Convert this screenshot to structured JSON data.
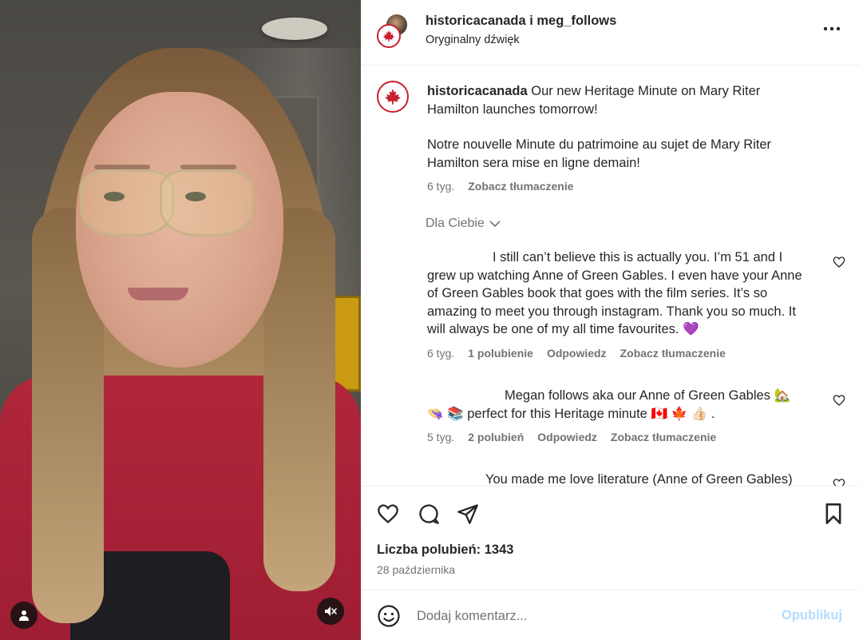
{
  "post_header": {
    "usernames": "historicacanada i meg_follows",
    "audio": "Oryginalny dźwięk",
    "more_icon": "more-horizontal-icon"
  },
  "caption": {
    "username": "historicacanada",
    "text_en": "Our new Heritage Minute on Mary Riter Hamilton launches tomorrow!",
    "text_fr": "Notre nouvelle Minute du patrimoine au sujet de Mary Riter Hamilton sera mise en ligne demain!",
    "time": "6 tyg.",
    "translate": "Zobacz tłumaczenie"
  },
  "filter": {
    "label": "Dla Ciebie"
  },
  "comments": [
    {
      "text": "I still can’t believe this is actually you. I’m 51 and I grew up watching Anne of Green Gables. I even have your Anne of Green Gables book that goes with the film series. It’s so amazing to meet you through instagram. Thank you so much. It will always be one of my all time favourites. 💜",
      "time": "6 tyg.",
      "likes": "1 polubienie",
      "reply": "Odpowiedz",
      "translate": "Zobacz tłumaczenie"
    },
    {
      "text": "Megan follows aka our Anne of Green Gables 🏡 👒 📚 perfect for this Heritage minute 🇨🇦 🍁 👍🏻 .",
      "time": "5 tyg.",
      "likes": "2 polubień",
      "reply": "Odpowiedz",
      "translate": "Zobacz tłumaczenie"
    },
    {
      "text": "You made me love literature (Anne of Green Gables)"
    }
  ],
  "stats": {
    "likes": "Liczba polubień: 1343",
    "date": "28 października"
  },
  "add_comment": {
    "placeholder": "Dodaj komentarz...",
    "publish": "Opublikuj"
  },
  "colors": {
    "brand_red": "#c8202f",
    "publish_disabled": "#b3dbff",
    "muted_text": "#737373"
  }
}
